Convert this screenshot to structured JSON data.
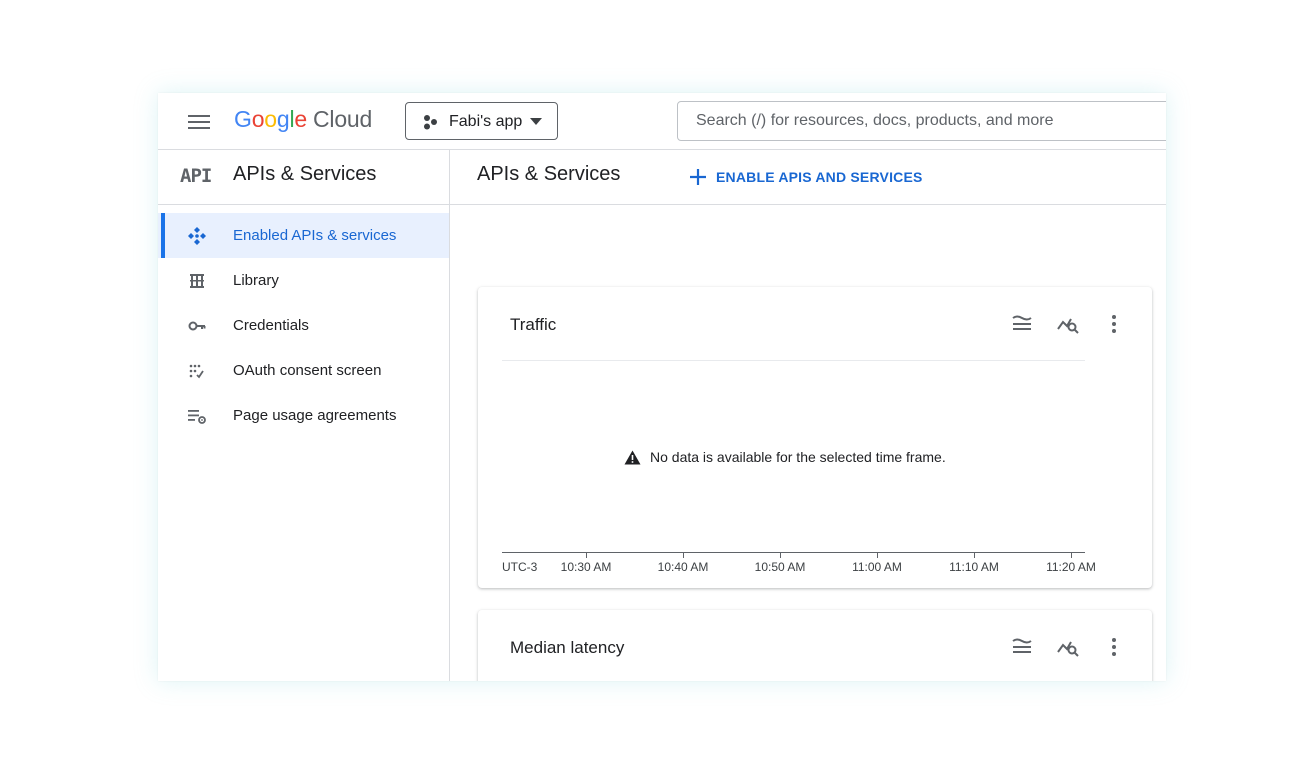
{
  "topbar": {
    "logo_letters": [
      "G",
      "o",
      "o",
      "g",
      "l",
      "e"
    ],
    "logo_cloud": "Cloud",
    "project": "Fabi's app",
    "search_placeholder": "Search (/) for resources, docs, products, and more"
  },
  "sidebar": {
    "badge": "API",
    "title": "APIs & Services",
    "items": [
      {
        "label": "Enabled APIs & services",
        "icon": "enabled-apis-icon",
        "active": true
      },
      {
        "label": "Library",
        "icon": "library-icon",
        "active": false
      },
      {
        "label": "Credentials",
        "icon": "key-icon",
        "active": false
      },
      {
        "label": "OAuth consent screen",
        "icon": "oauth-icon",
        "active": false
      },
      {
        "label": "Page usage agreements",
        "icon": "settings-list-icon",
        "active": false
      }
    ]
  },
  "main": {
    "title": "APIs & Services",
    "enable_button": "ENABLE APIS AND SERVICES"
  },
  "cards": {
    "traffic": {
      "title": "Traffic",
      "message": "No data is available for the selected time frame.",
      "timezone": "UTC-3",
      "ticks": [
        "10:30 AM",
        "10:40 AM",
        "10:50 AM",
        "11:00 AM",
        "11:10 AM",
        "11:20 AM"
      ]
    },
    "latency": {
      "title": "Median latency"
    }
  },
  "colors": {
    "accent": "#1967d2",
    "active_bg": "#e8f0fe",
    "border": "#dadce0"
  }
}
